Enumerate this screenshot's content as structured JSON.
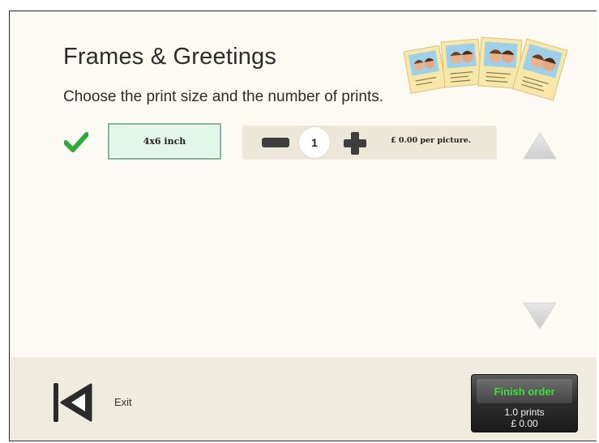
{
  "header": {
    "title": "Frames & Greetings",
    "subtitle": "Choose the print size and the number of prints."
  },
  "options": [
    {
      "selected": true,
      "size_label": "4x6 inch",
      "quantity": "1",
      "price_label": "£ 0.00 per picture."
    }
  ],
  "icons": {
    "selected": "checkmark-icon",
    "decrease": "minus-icon",
    "increase": "plus-icon",
    "scroll_up": "triangle-up-icon",
    "scroll_down": "triangle-down-icon",
    "exit": "skip-back-icon"
  },
  "footer": {
    "exit_label": "Exit",
    "finish_label": "Finish order",
    "prints_summary": "1.0 prints",
    "total_summary": "£ 0.00"
  },
  "colors": {
    "background": "#fcfaf3",
    "accent_green": "#3ddc3d",
    "check_green": "#2eaa3c",
    "selected_border": "#7fb79c"
  }
}
